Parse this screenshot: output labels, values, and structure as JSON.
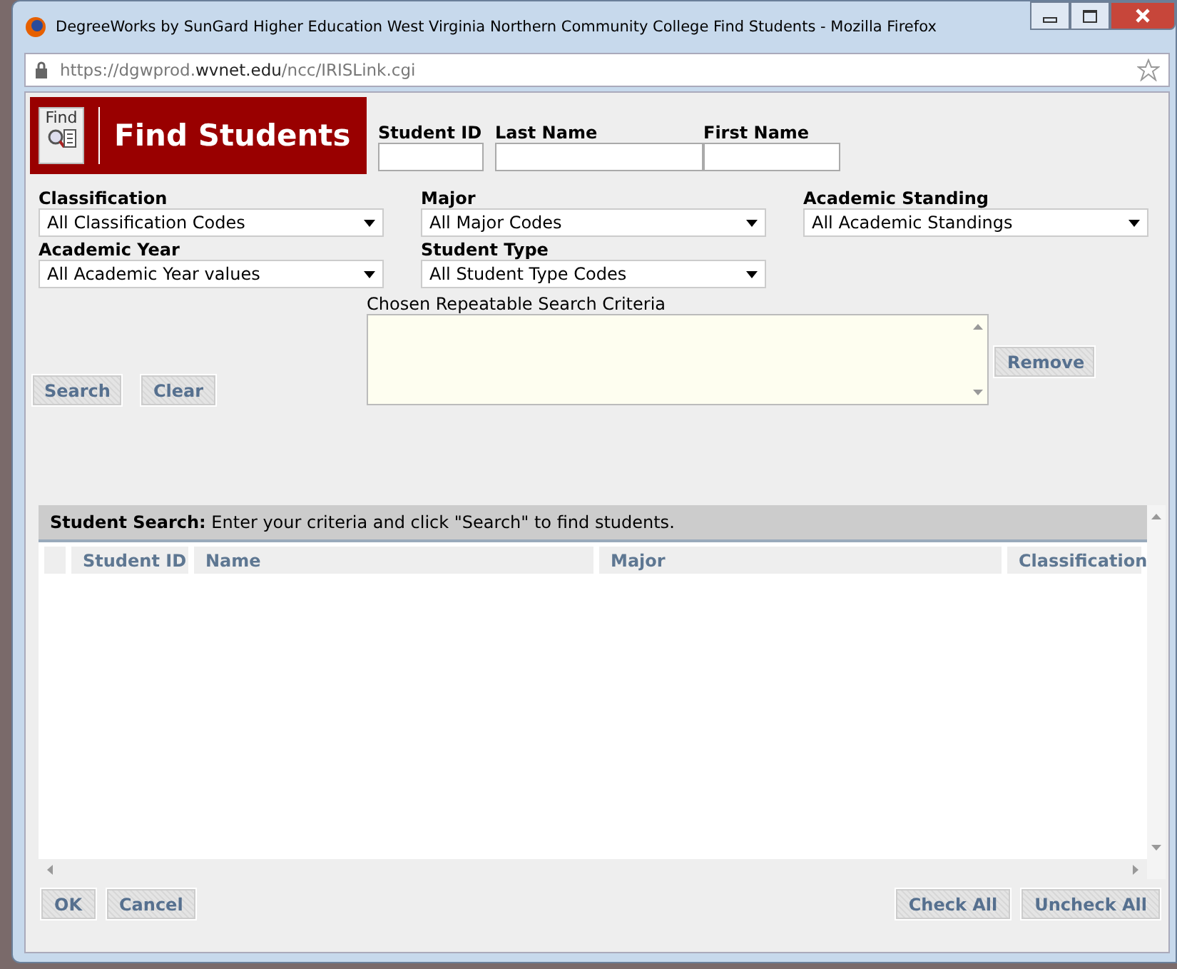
{
  "window": {
    "title": "DegreeWorks by SunGard Higher Education West Virginia Northern Community College Find Students - Mozilla Firefox"
  },
  "address_bar": {
    "url_prefix": "https://dgwprod.",
    "url_domain": "wvnet.edu",
    "url_path": "/ncc/IRISLink.cgi"
  },
  "header": {
    "icon_label": "Find",
    "title": "Find Students"
  },
  "id_fields": [
    {
      "label": "Student ID"
    },
    {
      "label": "Last Name"
    },
    {
      "label": "First Name"
    }
  ],
  "filters": [
    {
      "label": "Classification",
      "value": "All Classification Codes"
    },
    {
      "label": "Major",
      "value": "All Major Codes"
    },
    {
      "label": "Academic Standing",
      "value": "All Academic Standings"
    },
    {
      "label": "Academic Year",
      "value": "All Academic Year values"
    },
    {
      "label": "Student Type",
      "value": "All Student Type Codes"
    }
  ],
  "criteria": {
    "label": "Chosen Repeatable Search Criteria",
    "remove_button": "Remove"
  },
  "search_buttons": [
    "Search",
    "Clear"
  ],
  "results": {
    "title": "Student Search:",
    "hint": "Enter your criteria and click \"Search\" to find students.",
    "columns": [
      "Student ID",
      "Name",
      "Major",
      "Classification"
    ]
  },
  "footer_left": [
    "OK",
    "Cancel"
  ],
  "footer_right": [
    "Check All",
    "Uncheck All"
  ]
}
